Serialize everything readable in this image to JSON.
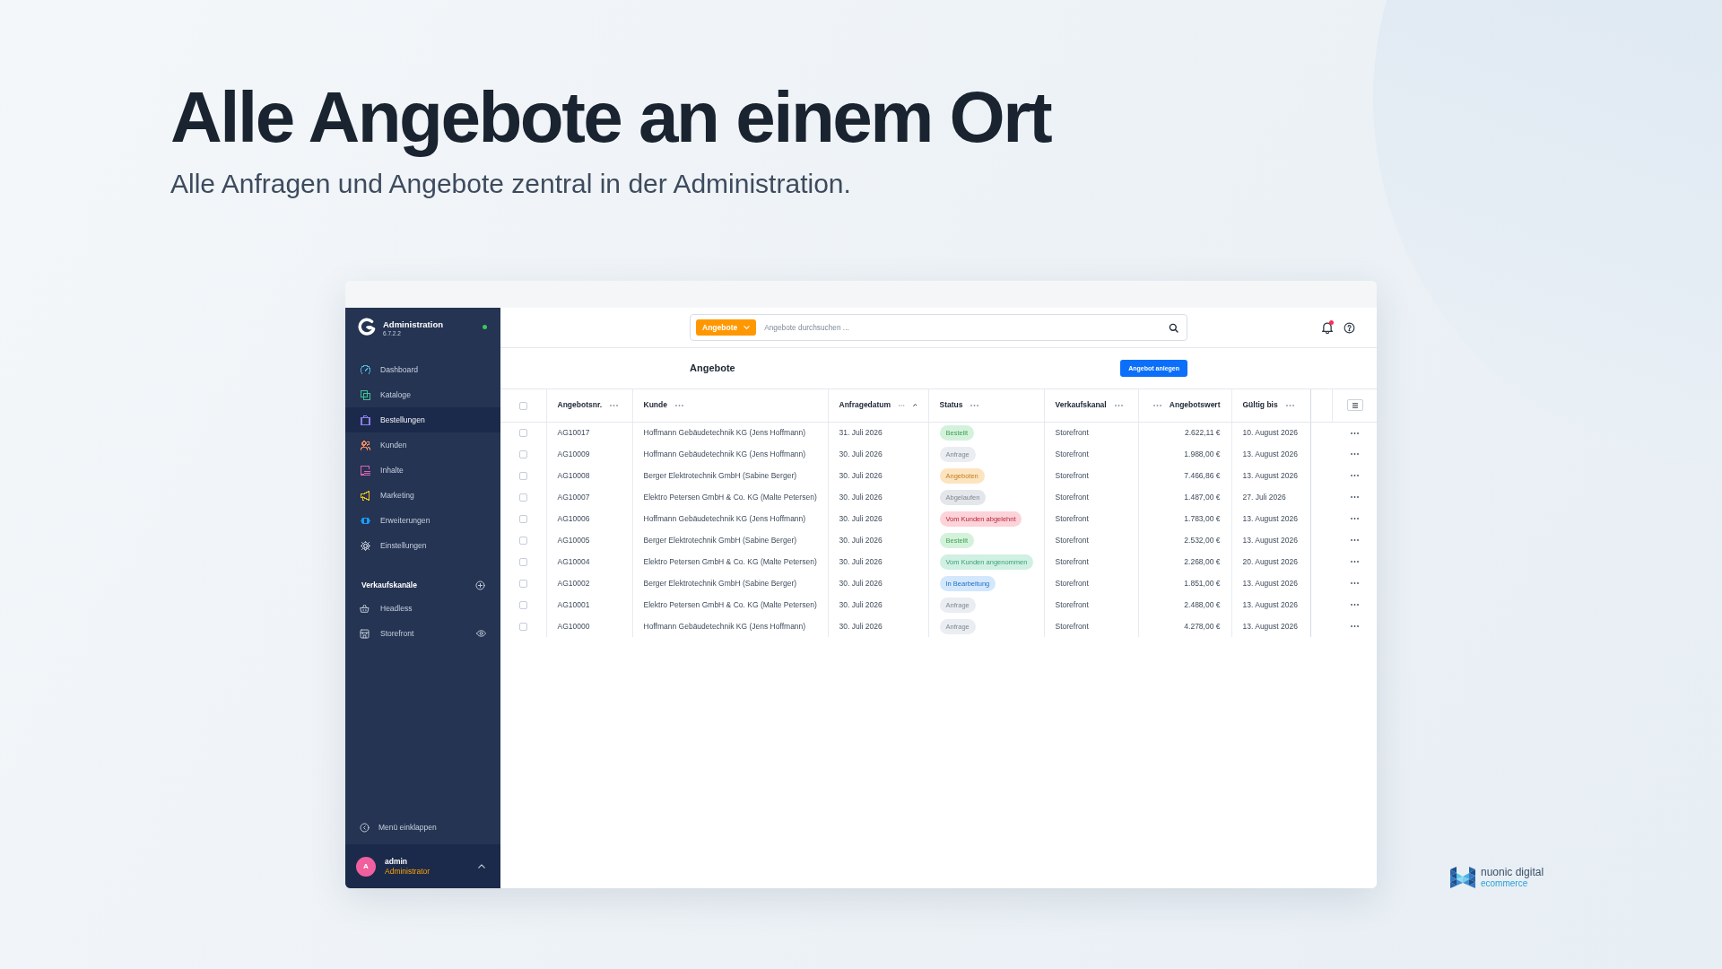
{
  "hero": {
    "title": "Alle Angebote an einem Ort",
    "subtitle": "Alle Anfragen und Angebote zentral in der Administration."
  },
  "sidebar": {
    "brand": {
      "title": "Administration",
      "version": "6.7.2.2",
      "online": true
    },
    "items": [
      {
        "label": "Dashboard",
        "selected": false,
        "color": "#53b3d8"
      },
      {
        "label": "Kataloge",
        "selected": false,
        "color": "#3cc291"
      },
      {
        "label": "Bestellungen",
        "selected": true,
        "color": "#8f7ff0"
      },
      {
        "label": "Kunden",
        "selected": false,
        "color": "#f08a5d"
      },
      {
        "label": "Inhalte",
        "selected": false,
        "color": "#e063b0"
      },
      {
        "label": "Marketing",
        "selected": false,
        "color": "#f2c019"
      },
      {
        "label": "Erweiterungen",
        "selected": false,
        "color": "#1a9bfa"
      },
      {
        "label": "Einstellungen",
        "selected": false,
        "color": "#aab4c3"
      }
    ],
    "sales_channels": {
      "title": "Verkaufskanäle",
      "items": [
        {
          "label": "Headless",
          "kind": "headless"
        },
        {
          "label": "Storefront",
          "kind": "storefront"
        }
      ]
    },
    "collapse": "Menü einklappen",
    "user": {
      "initial": "A",
      "name": "admin",
      "role": "Administrator"
    }
  },
  "topbar": {
    "search": {
      "scope": "Angebote",
      "placeholder": "Angebote durchsuchen ..."
    },
    "notifications": {
      "unread": true
    }
  },
  "page": {
    "title": "Angebote",
    "button": "Angebot anlegen"
  },
  "table": {
    "select_all": {
      "checked": false
    },
    "columns": [
      {
        "label": "Angebotsnr.",
        "kind": "text",
        "sorted": false
      },
      {
        "label": "Kunde",
        "kind": "text",
        "sorted": false
      },
      {
        "label": "Anfragedatum",
        "kind": "text",
        "sorted": true
      },
      {
        "label": "Status",
        "kind": "status",
        "sorted": false
      },
      {
        "label": "Verkaufskanal",
        "kind": "text",
        "sorted": false
      },
      {
        "label": "Angebotswert",
        "kind": "amount",
        "sorted": false
      },
      {
        "label": "Gültig bis",
        "kind": "text",
        "sorted": false
      }
    ],
    "rows": [
      {
        "selected": false,
        "cells": [
          "AG10017",
          "Hoffmann Gebäudetechnik KG (Jens Hoffmann)",
          "31. Juli 2026",
          {
            "label": "Bestellt",
            "color": "#d4f2db"
          },
          "Storefront",
          "2.622,11 €",
          "10. August 2026"
        ]
      },
      {
        "selected": false,
        "cells": [
          "AG10009",
          "Hoffmann Gebäudetechnik KG (Jens Hoffmann)",
          "30. Juli 2026",
          {
            "label": "Anfrage",
            "color": "#eaedf1"
          },
          "Storefront",
          "1.988,00 €",
          "13. August 2026"
        ]
      },
      {
        "selected": false,
        "cells": [
          "AG10008",
          "Berger Elektrotechnik GmbH (Sabine Berger)",
          "30. Juli 2026",
          {
            "label": "Angeboten",
            "color": "#fde4c0"
          },
          "Storefront",
          "7.466,86 €",
          "13. August 2026"
        ]
      },
      {
        "selected": false,
        "cells": [
          "AG10007",
          "Elektro Petersen GmbH & Co. KG (Malte Petersen)",
          "30. Juli 2026",
          {
            "label": "Abgelaufen",
            "color": "#e3e6ea"
          },
          "Storefront",
          "1.487,00 €",
          "27. Juli 2026"
        ]
      },
      {
        "selected": false,
        "cells": [
          "AG10006",
          "Hoffmann Gebäudetechnik KG (Jens Hoffmann)",
          "30. Juli 2026",
          {
            "label": "Vom Kunden abgelehnt",
            "color": "#fbd3d9"
          },
          "Storefront",
          "1.783,00 €",
          "13. August 2026"
        ]
      },
      {
        "selected": false,
        "cells": [
          "AG10005",
          "Berger Elektrotechnik GmbH (Sabine Berger)",
          "30. Juli 2026",
          {
            "label": "Bestellt",
            "color": "#d4f2db"
          },
          "Storefront",
          "2.532,00 €",
          "13. August 2026"
        ]
      },
      {
        "selected": false,
        "cells": [
          "AG10004",
          "Elektro Petersen GmbH & Co. KG (Malte Petersen)",
          "30. Juli 2026",
          {
            "label": "Vom Kunden angenommen",
            "color": "#cff0e3"
          },
          "Storefront",
          "2.268,00 €",
          "20. August 2026"
        ]
      },
      {
        "selected": false,
        "cells": [
          "AG10002",
          "Berger Elektrotechnik GmbH (Sabine Berger)",
          "30. Juli 2026",
          {
            "label": "In Bearbeitung",
            "color": "#d3e7fd"
          },
          "Storefront",
          "1.851,00 €",
          "13. August 2026"
        ]
      },
      {
        "selected": false,
        "cells": [
          "AG10001",
          "Elektro Petersen GmbH & Co. KG (Malte Petersen)",
          "30. Juli 2026",
          {
            "label": "Anfrage",
            "color": "#eaedf1"
          },
          "Storefront",
          "2.488,00 €",
          "13. August 2026"
        ]
      },
      {
        "selected": false,
        "cells": [
          "AG10000",
          "Hoffmann Gebäudetechnik KG (Jens Hoffmann)",
          "30. Juli 2026",
          {
            "label": "Anfrage",
            "color": "#eaedf1"
          },
          "Storefront",
          "4.278,00 €",
          "13. August 2026"
        ]
      }
    ]
  },
  "logo": {
    "name": "nuonic digital",
    "tagline": "ecommerce"
  }
}
